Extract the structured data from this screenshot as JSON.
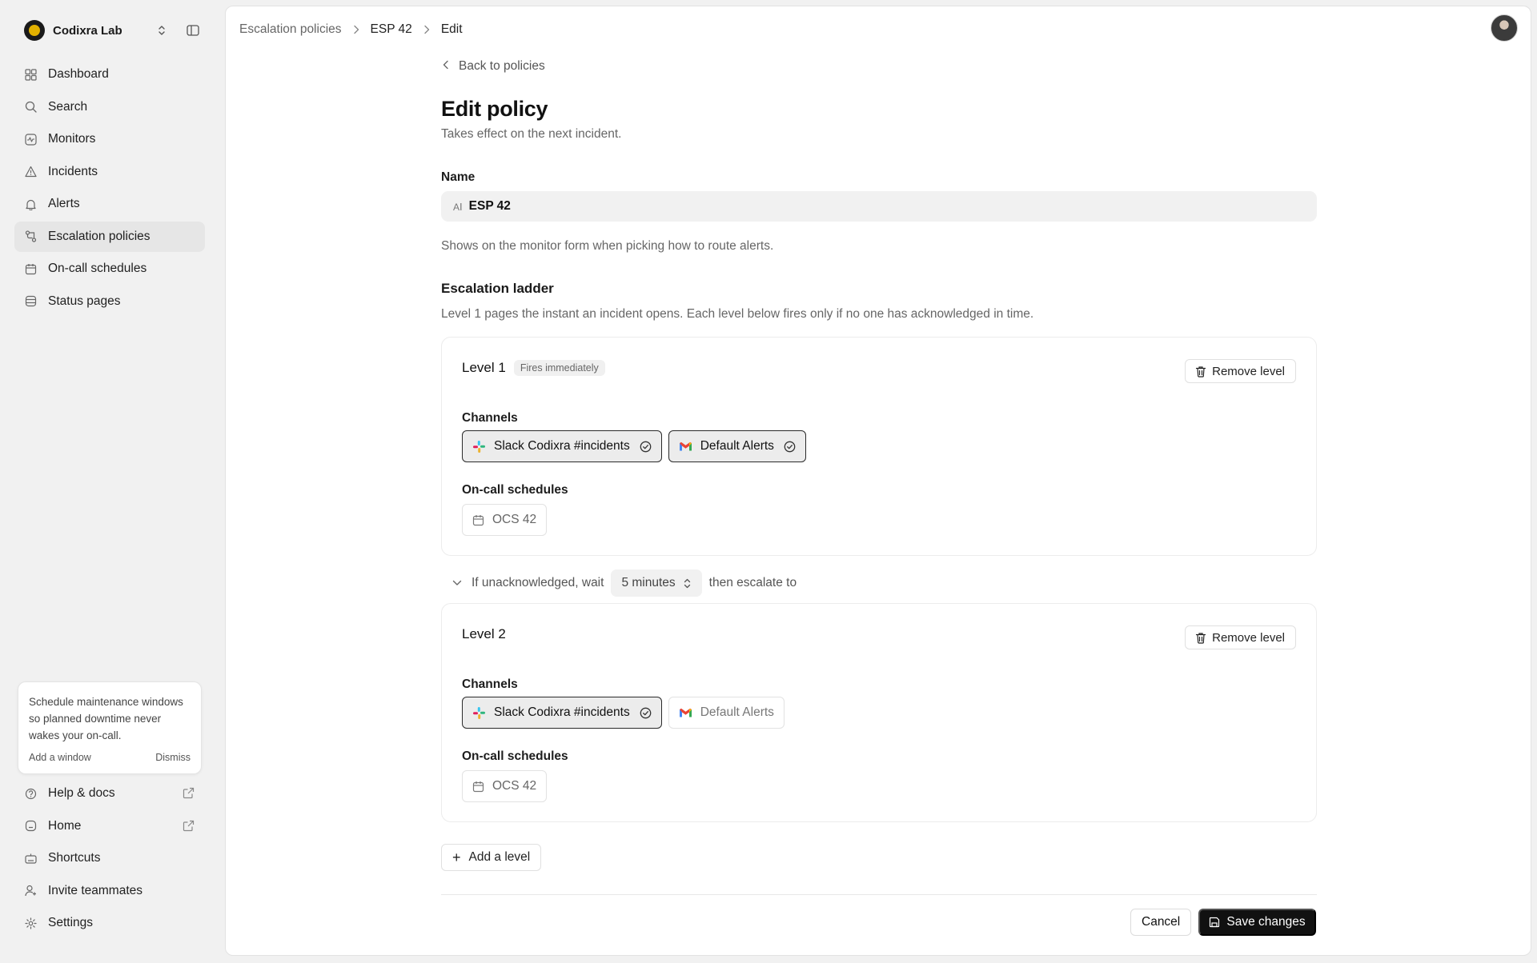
{
  "org": {
    "name": "Codixra Lab"
  },
  "sidebar": {
    "items": [
      {
        "label": "Dashboard",
        "icon": "dashboard-icon"
      },
      {
        "label": "Search",
        "icon": "search-icon"
      },
      {
        "label": "Monitors",
        "icon": "monitor-icon"
      },
      {
        "label": "Incidents",
        "icon": "warning-icon"
      },
      {
        "label": "Alerts",
        "icon": "bell-icon"
      },
      {
        "label": "Escalation policies",
        "icon": "escalation-icon",
        "active": true
      },
      {
        "label": "On-call schedules",
        "icon": "calendar-icon"
      },
      {
        "label": "Status pages",
        "icon": "status-page-icon"
      }
    ],
    "promo": {
      "text": "Schedule maintenance windows so planned downtime never wakes your on-call.",
      "action": "Add a window",
      "dismiss": "Dismiss"
    },
    "bottom": [
      {
        "label": "Help & docs",
        "icon": "help-icon",
        "external": true
      },
      {
        "label": "Home",
        "icon": "home-icon",
        "external": true
      },
      {
        "label": "Shortcuts",
        "icon": "keyboard-icon"
      },
      {
        "label": "Invite teammates",
        "icon": "user-plus-icon"
      },
      {
        "label": "Settings",
        "icon": "gear-icon"
      }
    ]
  },
  "breadcrumb": [
    "Escalation policies",
    "ESP 42",
    "Edit"
  ],
  "page": {
    "back": "Back to policies",
    "title": "Edit policy",
    "subtitle": "Takes effect on the next incident.",
    "name_label": "Name",
    "name_value": "ESP 42",
    "name_help": "Shows on the monitor form when picking how to route alerts.",
    "ladder_title": "Escalation ladder",
    "ladder_sub": "Level 1 pages the instant an incident opens. Each level below fires only if no one has acknowledged in time."
  },
  "levels": [
    {
      "title": "Level 1",
      "badge": "Fires immediately",
      "remove": "Remove level",
      "channels_label": "Channels",
      "channels": [
        {
          "label": "Slack Codixra #incidents",
          "selected": true
        },
        {
          "label": "Default Alerts",
          "selected": true
        }
      ],
      "schedules_label": "On-call schedules",
      "schedule": "OCS 42"
    },
    {
      "title": "Level 2",
      "remove": "Remove level",
      "channels_label": "Channels",
      "channels": [
        {
          "label": "Slack Codixra #incidents",
          "selected": true
        },
        {
          "label": "Default Alerts",
          "selected": false
        }
      ],
      "schedules_label": "On-call schedules",
      "schedule": "OCS 42"
    }
  ],
  "wait": {
    "prefix": "If unacknowledged, wait",
    "value": "5 minutes",
    "suffix": "then escalate to"
  },
  "actions": {
    "add_level": "Add a level",
    "cancel": "Cancel",
    "save": "Save changes"
  },
  "colors": {
    "brand": "#e2b100",
    "primary_button": "#111111",
    "active_nav": "#e6e6e6"
  }
}
